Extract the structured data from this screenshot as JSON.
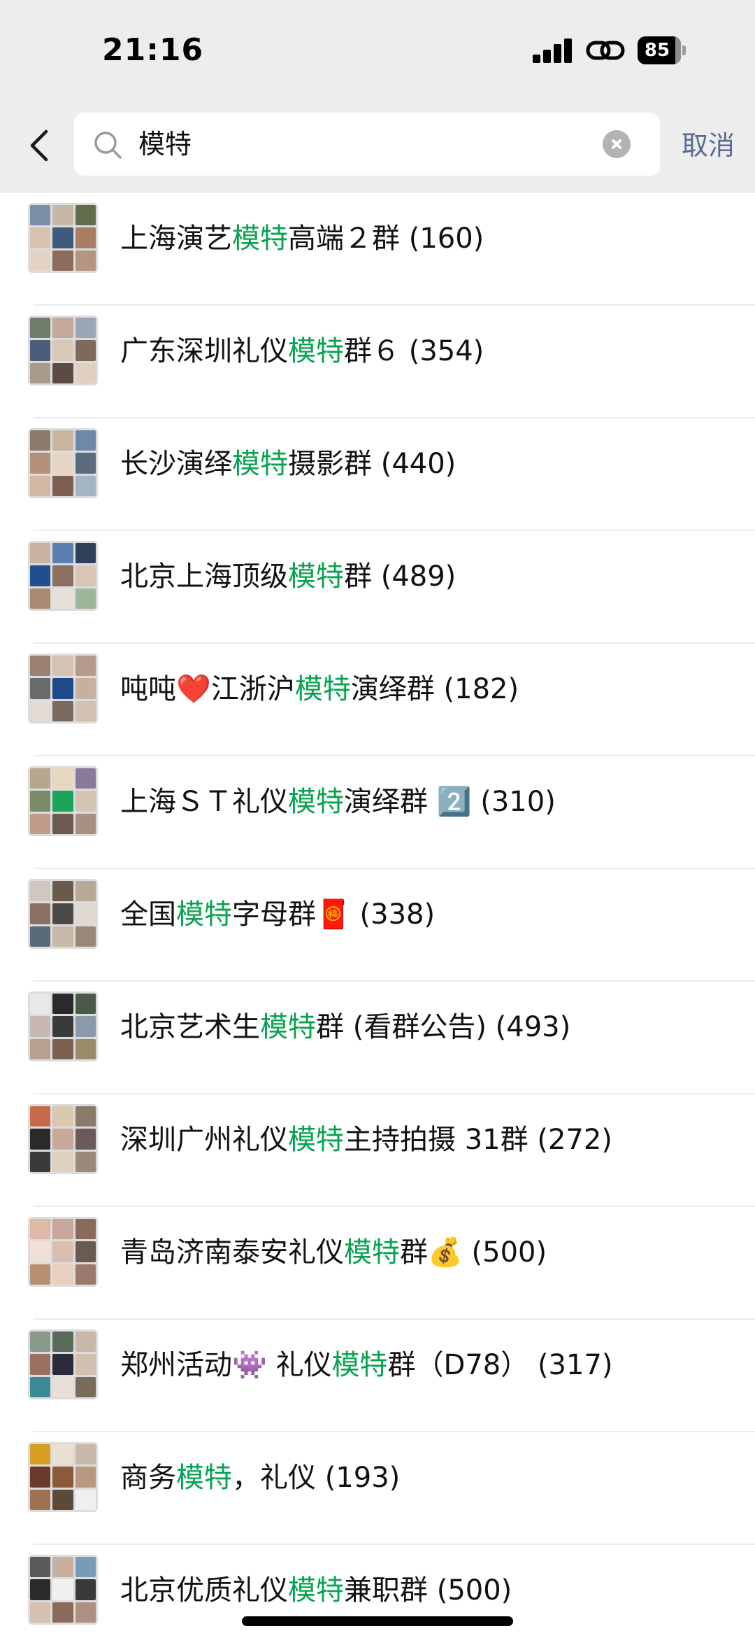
{
  "status_bar": {
    "time": "21:16",
    "battery": "85"
  },
  "search": {
    "query": "模特",
    "cancel_label": "取消"
  },
  "results": [
    {
      "before": "上海演艺",
      "match": "模特",
      "after": "高端２群",
      "count": "(160)"
    },
    {
      "before": "广东深圳礼仪",
      "match": "模特",
      "after": "群６",
      "count": "(354)"
    },
    {
      "before": "长沙演绎",
      "match": "模特",
      "after": "摄影群",
      "count": "(440)"
    },
    {
      "before": "北京上海顶级",
      "match": "模特",
      "after": "群",
      "count": "(489)"
    },
    {
      "before": "吨吨❤️江浙沪",
      "match": "模特",
      "after": "演绎群",
      "count": "(182)"
    },
    {
      "before": "上海ＳＴ礼仪",
      "match": "模特",
      "after": "演绎群 2️⃣",
      "count": "(310)"
    },
    {
      "before": "全国",
      "match": "模特",
      "after": "字母群🧧",
      "count": "(338)"
    },
    {
      "before": "北京艺术生",
      "match": "模特",
      "after": "群 (看群公告)",
      "count": "(493)"
    },
    {
      "before": "深圳广州礼仪",
      "match": "模特",
      "after": "主持拍摄 31群",
      "count": "(272)"
    },
    {
      "before": "青岛济南泰安礼仪",
      "match": "模特",
      "after": "群💰",
      "count": "(500)"
    },
    {
      "before": "郑州活动👾 礼仪",
      "match": "模特",
      "after": "群（D78）",
      "count": "(317)"
    },
    {
      "before": "商务",
      "match": "模特",
      "after": "，礼仪",
      "count": "(193)"
    },
    {
      "before": "北京优质礼仪",
      "match": "模特",
      "after": "兼职群",
      "count": "(500)"
    }
  ]
}
